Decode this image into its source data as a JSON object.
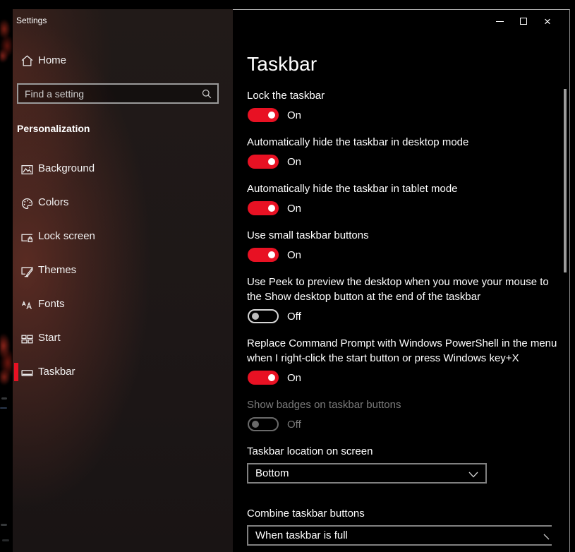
{
  "window": {
    "title": "Settings",
    "close_glyph": "×"
  },
  "sidebar": {
    "home_label": "Home",
    "search_placeholder": "Find a setting",
    "section_header": "Personalization",
    "items": [
      {
        "label": "Background",
        "icon": "background-icon",
        "selected": false
      },
      {
        "label": "Colors",
        "icon": "colors-icon",
        "selected": false
      },
      {
        "label": "Lock screen",
        "icon": "lock-screen-icon",
        "selected": false
      },
      {
        "label": "Themes",
        "icon": "themes-icon",
        "selected": false
      },
      {
        "label": "Fonts",
        "icon": "fonts-icon",
        "selected": false
      },
      {
        "label": "Start",
        "icon": "start-icon",
        "selected": false
      },
      {
        "label": "Taskbar",
        "icon": "taskbar-icon",
        "selected": true
      }
    ]
  },
  "main": {
    "title": "Taskbar",
    "toggles": [
      {
        "label": "Lock the taskbar",
        "state": "On",
        "enabled": true
      },
      {
        "label": "Automatically hide the taskbar in desktop mode",
        "state": "On",
        "enabled": true
      },
      {
        "label": "Automatically hide the taskbar in tablet mode",
        "state": "On",
        "enabled": true
      },
      {
        "label": "Use small taskbar buttons",
        "state": "On",
        "enabled": true
      },
      {
        "label": "Use Peek to preview the desktop when you move your mouse to the Show desktop button at the end of the taskbar",
        "state": "Off",
        "enabled": true
      },
      {
        "label": "Replace Command Prompt with Windows PowerShell in the menu when I right-click the start button or press Windows key+X",
        "state": "On",
        "enabled": true
      },
      {
        "label": "Show badges on taskbar buttons",
        "state": "Off",
        "enabled": false
      }
    ],
    "dropdowns": [
      {
        "label": "Taskbar location on screen",
        "value": "Bottom"
      },
      {
        "label": "Combine taskbar buttons",
        "value": "When taskbar is full"
      }
    ]
  },
  "colors": {
    "accent": "#e81123",
    "panel_bg": "#000000",
    "sidebar_tint": "#3a2421"
  }
}
